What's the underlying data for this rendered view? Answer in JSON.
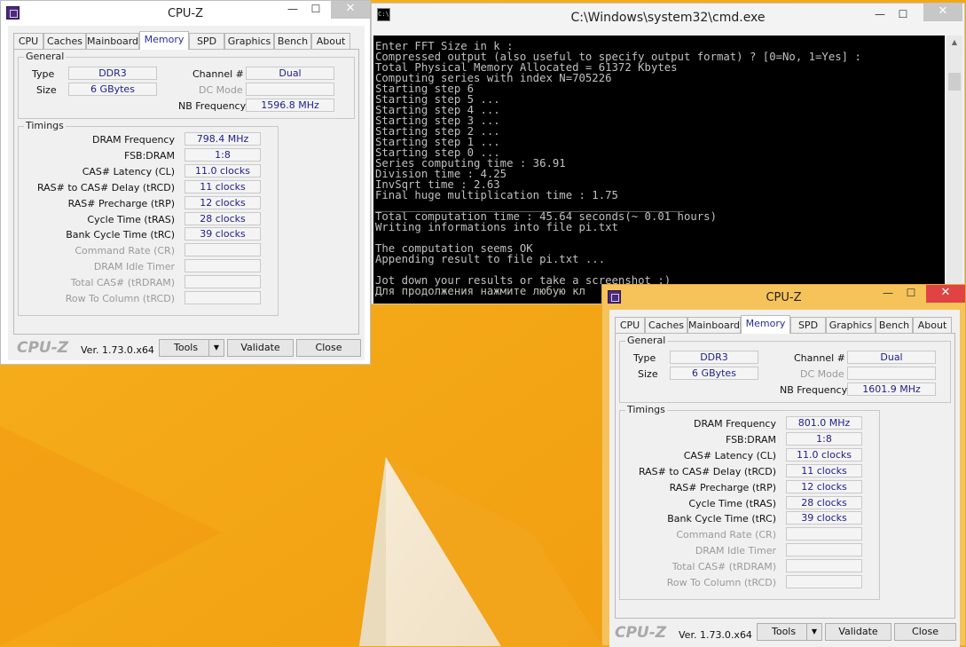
{
  "cpuz_left": {
    "title": "CPU-Z",
    "tabs": [
      "CPU",
      "Caches",
      "Mainboard",
      "Memory",
      "SPD",
      "Graphics",
      "Bench",
      "About"
    ],
    "active_tab": "Memory",
    "general_legend": "General",
    "type_label": "Type",
    "type_value": "DDR3",
    "size_label": "Size",
    "size_value": "6 GBytes",
    "channel_label": "Channel #",
    "channel_value": "Dual",
    "dc_mode_label": "DC Mode",
    "dc_mode_value": "",
    "nb_freq_label": "NB Frequency",
    "nb_freq_value": "1596.8 MHz",
    "timings_legend": "Timings",
    "timings": [
      {
        "label": "DRAM Frequency",
        "value": "798.4 MHz"
      },
      {
        "label": "FSB:DRAM",
        "value": "1:8"
      },
      {
        "label": "CAS# Latency (CL)",
        "value": "11.0 clocks"
      },
      {
        "label": "RAS# to CAS# Delay (tRCD)",
        "value": "11 clocks"
      },
      {
        "label": "RAS# Precharge (tRP)",
        "value": "12 clocks"
      },
      {
        "label": "Cycle Time (tRAS)",
        "value": "28 clocks"
      },
      {
        "label": "Bank Cycle Time (tRC)",
        "value": "39 clocks"
      },
      {
        "label": "Command Rate (CR)",
        "value": ""
      },
      {
        "label": "DRAM Idle Timer",
        "value": ""
      },
      {
        "label": "Total CAS# (tRDRAM)",
        "value": ""
      },
      {
        "label": "Row To Column (tRCD)",
        "value": ""
      }
    ],
    "brand": "CPU-Z",
    "version": "Ver. 1.73.0.x64",
    "tools_label": "Tools",
    "validate_label": "Validate",
    "close_label": "Close"
  },
  "cpuz_right": {
    "title": "CPU-Z",
    "tabs": [
      "CPU",
      "Caches",
      "Mainboard",
      "Memory",
      "SPD",
      "Graphics",
      "Bench",
      "About"
    ],
    "active_tab": "Memory",
    "general_legend": "General",
    "type_label": "Type",
    "type_value": "DDR3",
    "size_label": "Size",
    "size_value": "6 GBytes",
    "channel_label": "Channel #",
    "channel_value": "Dual",
    "dc_mode_label": "DC Mode",
    "dc_mode_value": "",
    "nb_freq_label": "NB Frequency",
    "nb_freq_value": "1601.9 MHz",
    "timings_legend": "Timings",
    "timings": [
      {
        "label": "DRAM Frequency",
        "value": "801.0 MHz"
      },
      {
        "label": "FSB:DRAM",
        "value": "1:8"
      },
      {
        "label": "CAS# Latency (CL)",
        "value": "11.0 clocks"
      },
      {
        "label": "RAS# to CAS# Delay (tRCD)",
        "value": "11 clocks"
      },
      {
        "label": "RAS# Precharge (tRP)",
        "value": "12 clocks"
      },
      {
        "label": "Cycle Time (tRAS)",
        "value": "28 clocks"
      },
      {
        "label": "Bank Cycle Time (tRC)",
        "value": "39 clocks"
      },
      {
        "label": "Command Rate (CR)",
        "value": ""
      },
      {
        "label": "DRAM Idle Timer",
        "value": ""
      },
      {
        "label": "Total CAS# (tRDRAM)",
        "value": ""
      },
      {
        "label": "Row To Column (tRCD)",
        "value": ""
      }
    ],
    "brand": "CPU-Z",
    "version": "Ver. 1.73.0.x64",
    "tools_label": "Tools",
    "validate_label": "Validate",
    "close_label": "Close"
  },
  "cmd": {
    "title": "C:\\Windows\\system32\\cmd.exe",
    "icon_text": "C:\\",
    "lines": [
      "Enter FFT Size in k :",
      "Compressed output (also useful to specify output format) ? [0=No, 1=Yes] :",
      "Total Physical Memory Allocated = 61372 Kbytes",
      "Computing series with index N=705226",
      "Starting step 6",
      "Starting step 5 ...",
      "Starting step 4 ...",
      "Starting step 3 ...",
      "Starting step 2 ...",
      "Starting step 1 ...",
      "Starting step 0 ...",
      "Series computing time : 36.91",
      "Division time : 4.25",
      "InvSqrt time : 2.63",
      "Final huge multiplication time : 1.75",
      "_______________________________________________",
      "Total computation time : 45.64 seconds(~ 0.01 hours)",
      "Writing informations into file pi.txt",
      "",
      "The computation seems OK",
      "Appending result to file pi.txt ...",
      "",
      "Jot down your results or take a screenshot :)",
      "Для продолжения нажмите любую кл"
    ]
  },
  "colors": {
    "desktop": "#f5a814",
    "accent_border": "#f0b43c",
    "close_red": "#e04343",
    "value_text": "#1d1d8c",
    "active_tab_text": "#2a2a9a"
  }
}
